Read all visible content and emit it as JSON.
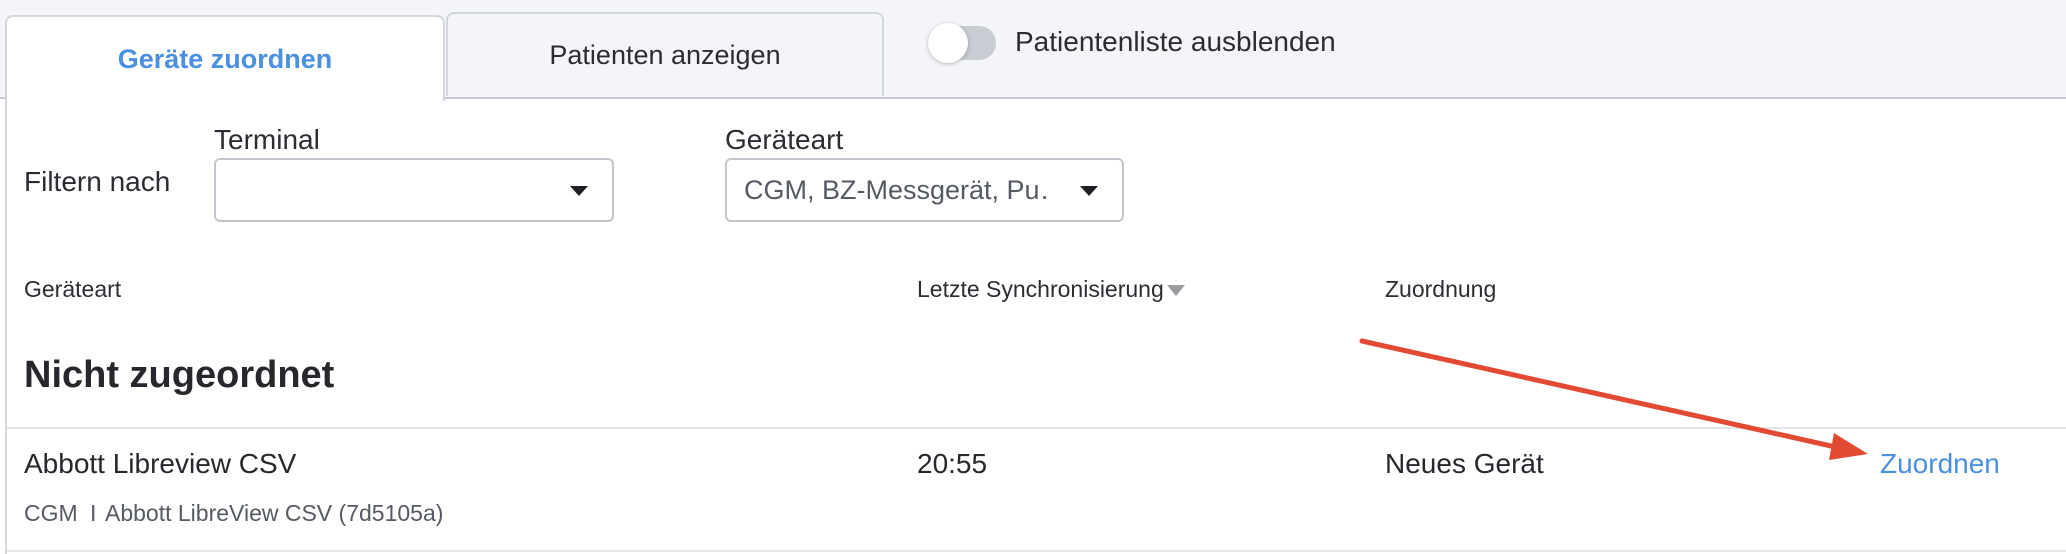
{
  "tabs": {
    "active": "Geräte zuordnen",
    "inactive": "Patienten anzeigen"
  },
  "toggle": {
    "label": "Patientenliste ausblenden",
    "on": false
  },
  "filters": {
    "label": "Filtern nach",
    "terminal": {
      "label": "Terminal",
      "value": ""
    },
    "device_type": {
      "label": "Geräteart",
      "value": "CGM, BZ-Messgerät, Pu…"
    }
  },
  "columns": {
    "device_type": "Geräteart",
    "last_sync": "Letzte Synchronisierung",
    "assignment": "Zuordnung"
  },
  "section": {
    "title": "Nicht zugeordnet"
  },
  "row": {
    "name": "Abbott Libreview CSV",
    "time": "20:55",
    "status": "Neues Gerät",
    "action": "Zuordnen",
    "sub_type": "CGM",
    "sub_sep": "I",
    "sub_detail": "Abbott LibreView CSV (7d5105a)"
  },
  "colors": {
    "accent": "#4a8fe0",
    "annotation_arrow": "#e24a33"
  }
}
